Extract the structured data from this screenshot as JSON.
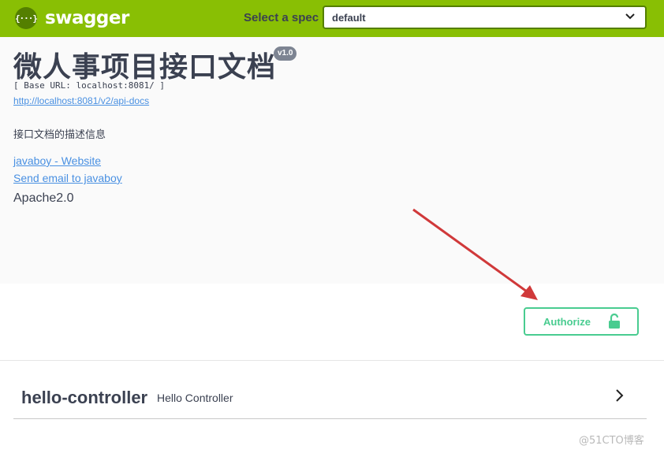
{
  "topbar": {
    "logo_glyph": "{···}",
    "logo_text": "swagger",
    "spec_label": "Select a spec",
    "spec_selected": "default",
    "bar_color": "#89bf04"
  },
  "info": {
    "title": "微人事项目接口文档",
    "version": "v1.0",
    "base_url": "[ Base URL: localhost:8081/ ]",
    "api_docs_url": "http://localhost:8081/v2/api-docs",
    "description": "接口文档的描述信息",
    "website_link": "javaboy - Website",
    "email_link": "Send email to javaboy",
    "license": "Apache2.0"
  },
  "auth": {
    "authorize_label": "Authorize",
    "icon": "unlock-icon",
    "accent": "#49cc90"
  },
  "tags": [
    {
      "name": "hello-controller",
      "description": "Hello Controller"
    }
  ],
  "watermark": "@51CTO博客",
  "annotation": {
    "arrow_color": "#d0393a"
  }
}
